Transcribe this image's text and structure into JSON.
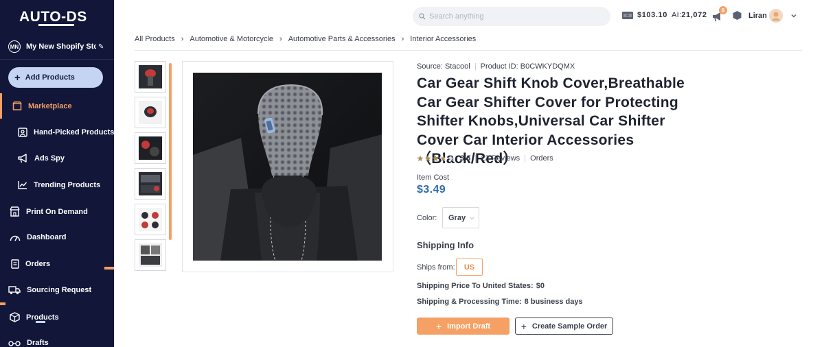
{
  "app": {
    "logo_text": "AUTO-DS"
  },
  "store": {
    "initials": "MN",
    "name": "My New Shopify Store"
  },
  "sidebar": {
    "add_products": "Add Products",
    "items": [
      {
        "label": "Marketplace",
        "icon": "store-icon"
      },
      {
        "label": "Hand-Picked Products",
        "icon": "handpicked-icon"
      },
      {
        "label": "Ads Spy",
        "icon": "megaphone-icon"
      },
      {
        "label": "Trending Products",
        "icon": "trending-icon"
      },
      {
        "label": "Print On Demand",
        "icon": "print-store-icon"
      },
      {
        "label": "Dashboard",
        "icon": "gauge-icon"
      },
      {
        "label": "Orders",
        "icon": "clipboard-icon"
      },
      {
        "label": "Sourcing Request",
        "icon": "truck-icon"
      },
      {
        "label": "Products",
        "icon": "box-icon"
      },
      {
        "label": "Drafts",
        "icon": "drafts-icon"
      }
    ]
  },
  "topbar": {
    "search_placeholder": "Search anything",
    "balance": "$103.10",
    "ai_prefix": "AI:",
    "ai_credits": "21,072",
    "notifications": "8",
    "user": "Liran"
  },
  "breadcrumb": [
    "All Products",
    "Automotive & Motorcycle",
    "Automotive Parts & Accessories",
    "Interior Accessories"
  ],
  "product": {
    "source": "Source: Stacool",
    "product_id": "Product ID: B0CWKYDQMX",
    "title": "Car Gear Shift Knob Cover,Breathable Car Gear Shifter Cover for Protecting Shifter Knobs,Universal Car Shifter Cover Car Interior Accessories（Black/Red）",
    "rating": "3.6",
    "rating_fraction": 0.72,
    "reviews": "22 Reviews",
    "orders": "Orders",
    "cost_label": "Item Cost",
    "cost": "$3.49",
    "color_label": "Color:",
    "color_value": "Gray",
    "shipping_title": "Shipping Info",
    "ships_from_label": "Ships from:",
    "ships_from_value": "US",
    "ship_price_label": "Shipping Price To United States:",
    "ship_price_value": "$0",
    "ship_time_label": "Shipping & Processing Time:",
    "ship_time_value": "8 business days"
  },
  "actions": {
    "import": "Import Draft",
    "sample": "Create Sample Order"
  },
  "colors": {
    "sidebar_bg": "#12173a",
    "accent_orange": "#f5a064",
    "price_blue": "#2f6ba8",
    "add_btn_bg": "#c6d4f3"
  }
}
